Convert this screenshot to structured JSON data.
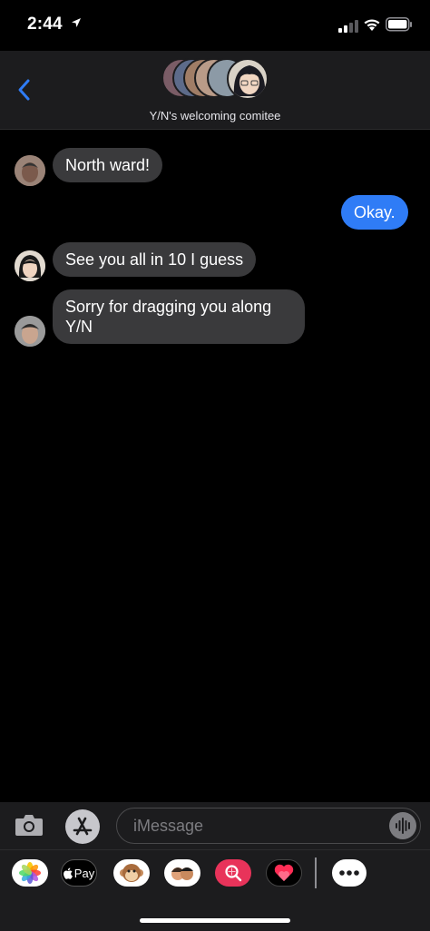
{
  "status": {
    "time": "2:44",
    "location_icon": "location-arrow-icon",
    "signal_icon": "cell-signal-icon",
    "wifi_icon": "wifi-icon",
    "battery_icon": "battery-icon"
  },
  "header": {
    "back_icon": "chevron-left-icon",
    "group_name": "Y/N's welcoming comitee"
  },
  "messages": [
    {
      "direction": "incoming",
      "text": "North ward!"
    },
    {
      "direction": "outgoing",
      "text": "Okay."
    },
    {
      "direction": "incoming",
      "text": "See you all in 10 I guess"
    },
    {
      "direction": "incoming",
      "text": "Sorry for dragging you along Y/N"
    }
  ],
  "input": {
    "placeholder": "iMessage",
    "camera_icon": "camera-icon",
    "appstore_icon": "app-store-icon",
    "audio_icon": "audio-waveform-icon"
  },
  "drawer": {
    "photos_icon": "photos-icon",
    "applepay_label": "Pay",
    "animoji_icon": "animoji-monkey-icon",
    "memoji_icon": "memoji-stickers-icon",
    "search_icon": "web-images-search-icon",
    "digital_touch_icon": "digital-touch-heart-icon",
    "more_icon": "more-apps-icon"
  },
  "colors": {
    "outgoing_bubble": "#2f7cf6",
    "incoming_bubble": "#3a3a3c",
    "background": "#000000",
    "accent": "#2f7cf6"
  }
}
